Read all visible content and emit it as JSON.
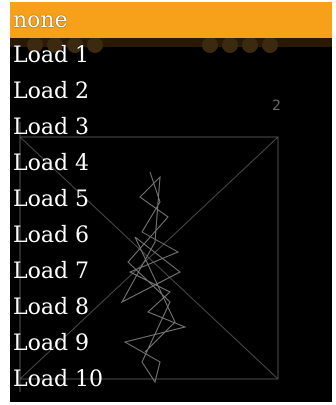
{
  "menu": {
    "selected_index": 0,
    "accent_color": "#f7a11b",
    "items": [
      {
        "label": "none"
      },
      {
        "label": "Load 1"
      },
      {
        "label": "Load 2"
      },
      {
        "label": "Load 3"
      },
      {
        "label": "Load 4"
      },
      {
        "label": "Load 5"
      },
      {
        "label": "Load 6"
      },
      {
        "label": "Load 7"
      },
      {
        "label": "Load 8"
      },
      {
        "label": "Load 9"
      },
      {
        "label": "Load 10"
      }
    ]
  },
  "background": {
    "axis_tick_label": "2"
  }
}
